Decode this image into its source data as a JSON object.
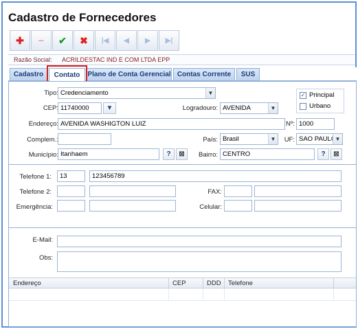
{
  "window": {
    "title": "Cadastro de Fornecedores"
  },
  "toolbar": {
    "add": "✚",
    "remove": "−",
    "confirm": "✔",
    "cancel": "✖",
    "first": "|◀",
    "prev": "◀",
    "next": "▶",
    "last": "▶|"
  },
  "razao": {
    "label": "Razão Social:",
    "value": "ACRILDESTAC IND E COM LTDA EPP"
  },
  "tabs": [
    {
      "label": "Cadastro"
    },
    {
      "label": "Contato"
    },
    {
      "label": "Plano de Conta Gerencial"
    },
    {
      "label": "Contas Corrente"
    },
    {
      "label": "SUS"
    }
  ],
  "address": {
    "tipo_label": "Tipo:",
    "tipo_value": "Credenciamento",
    "cep_label": "CEP:",
    "cep_value": "11740000",
    "logradouro_label": "Logradouro:",
    "logradouro_value": "AVENIDA",
    "endereco_label": "Endereço:",
    "endereco_value": "AVENIDA WASHIGTON LUIZ",
    "numero_label": "Nº:",
    "numero_value": "1000",
    "complem_label": "Complem.:",
    "complem_value": "",
    "pais_label": "País:",
    "pais_value": "Brasil",
    "uf_label": "UF:",
    "uf_value": "SAO PAULO",
    "municipio_label": "Município:",
    "municipio_value": "Itanhaem",
    "bairro_label": "Bairro:",
    "bairro_value": "CENTRO",
    "principal_label": "Principal",
    "principal_checked": true,
    "urbano_label": "Urbano",
    "urbano_checked": false
  },
  "phones": {
    "telefone1_label": "Telefone 1:",
    "telefone1_ddd": "13",
    "telefone1_number": "123456789",
    "telefone2_label": "Telefone 2:",
    "telefone2_ddd": "",
    "telefone2_number": "",
    "fax_label": "FAX:",
    "fax_ddd": "",
    "fax_number": "",
    "emergencia_label": "Emergência:",
    "emergencia_ddd": "",
    "emergencia_number": "",
    "celular_label": "Celular:",
    "celular_ddd": "",
    "celular_number": ""
  },
  "contact": {
    "email_label": "E-Mail:",
    "email_value": "",
    "obs_label": "Obs:",
    "obs_value": ""
  },
  "grid": {
    "columns": [
      "Endereço",
      "CEP",
      "DDD",
      "Telefone"
    ]
  },
  "icons": {
    "search": "?",
    "clear": "⊠",
    "dropdown": "▼",
    "check": "✓"
  },
  "colors": {
    "accent": "#5b8fd6",
    "tab_text": "#1d3c7a",
    "highlight": "#d81c1c"
  }
}
